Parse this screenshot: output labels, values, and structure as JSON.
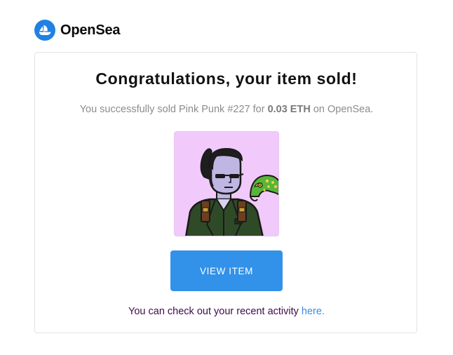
{
  "brand": {
    "name": "OpenSea",
    "color": "#2081e2",
    "icon": "opensea-sailboat-icon"
  },
  "email": {
    "title": "Congratulations, your item sold!",
    "message": {
      "prefix": "You successfully sold Pink Punk #227 for",
      "price": "0.03 ETH",
      "suffix": "on OpenSea."
    },
    "item_image": {
      "icon": "pink-punk-nft-image",
      "background_color": "#f2c9fb"
    },
    "cta_button": {
      "label": "VIEW ITEM",
      "color": "#3291e9"
    },
    "footer": {
      "text": "You can check out your recent activity",
      "link_label": "here."
    }
  }
}
